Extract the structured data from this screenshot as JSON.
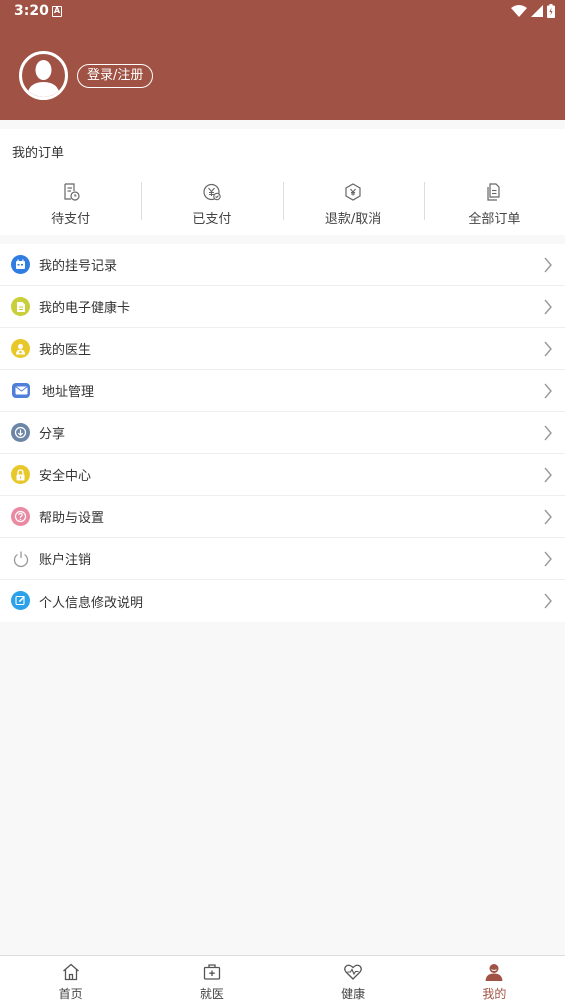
{
  "status": {
    "time": "3:20",
    "notif": "A"
  },
  "header": {
    "login_label": "登录/注册"
  },
  "orders": {
    "title": "我的订单",
    "items": [
      {
        "label": "待支付",
        "icon": "pending-payment-icon"
      },
      {
        "label": "已支付",
        "icon": "paid-yen-icon"
      },
      {
        "label": "退款/取消",
        "icon": "refund-icon"
      },
      {
        "label": "全部订单",
        "icon": "all-orders-icon"
      }
    ]
  },
  "menu": [
    {
      "label": "我的挂号记录",
      "icon": "calendar-icon",
      "color": "#2f7de1"
    },
    {
      "label": "我的电子健康卡",
      "icon": "document-icon",
      "color": "#c8cf3a"
    },
    {
      "label": "我的医生",
      "icon": "doctor-icon",
      "color": "#e8c72a"
    },
    {
      "label": "地址管理",
      "icon": "envelope-icon",
      "color": "#4f7fd9"
    },
    {
      "label": "分享",
      "icon": "share-icon",
      "color": "#6d86a8"
    },
    {
      "label": "安全中心",
      "icon": "lock-icon",
      "color": "#e8c72a"
    },
    {
      "label": "帮助与设置",
      "icon": "help-icon",
      "color": "#e98aa2"
    },
    {
      "label": "账户注销",
      "icon": "power-icon",
      "color": "#999999"
    },
    {
      "label": "个人信息修改说明",
      "icon": "edit-icon",
      "color": "#2aa1e8"
    }
  ],
  "tabs": [
    {
      "label": "首页",
      "icon": "home-icon"
    },
    {
      "label": "就医",
      "icon": "medical-kit-icon"
    },
    {
      "label": "健康",
      "icon": "heart-pulse-icon"
    },
    {
      "label": "我的",
      "icon": "user-icon",
      "active": true
    }
  ],
  "colors": {
    "brand": "#a05244",
    "background": "#f8f8f8"
  }
}
